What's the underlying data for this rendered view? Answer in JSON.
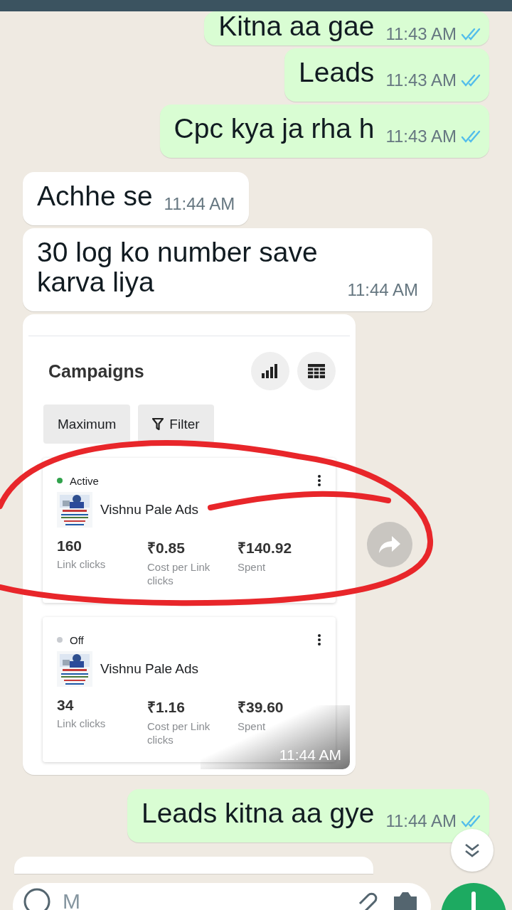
{
  "messages": [
    {
      "kind": "text",
      "outgoing": true,
      "text": "Kitna aa gae",
      "time": "11:43 AM",
      "read": true
    },
    {
      "kind": "text",
      "outgoing": true,
      "text": "Leads",
      "time": "11:43 AM",
      "read": true
    },
    {
      "kind": "text",
      "outgoing": true,
      "text": "Cpc kya ja rha h",
      "time": "11:43 AM",
      "read": true
    },
    {
      "kind": "text",
      "outgoing": false,
      "text": "Achhe se",
      "time": "11:44 AM"
    },
    {
      "kind": "text",
      "outgoing": false,
      "text": "30 log ko number save karva liya",
      "time": "11:44 AM"
    },
    {
      "outgoing": false,
      "time": "11:44 AM",
      "screenshot": {
        "title": "Campaigns",
        "sort_button": "Maximum",
        "filter_button": "Filter",
        "campaigns": [
          {
            "status": "Active",
            "active": true,
            "name": "Vishnu Pale Ads",
            "metrics": [
              {
                "value": "160",
                "label": "Link clicks"
              },
              {
                "value": "₹0.85",
                "label": "Cost per Link clicks"
              },
              {
                "value": "₹140.92",
                "label": "Spent"
              }
            ]
          },
          {
            "status": "Off",
            "active": false,
            "name": "Vishnu Pale Ads",
            "metrics": [
              {
                "value": "34",
                "label": "Link clicks"
              },
              {
                "value": "₹1.16",
                "label": "Cost per Link clicks"
              },
              {
                "value": "₹39.60",
                "label": "Spent"
              }
            ]
          }
        ]
      }
    },
    {
      "kind": "text",
      "outgoing": true,
      "text": "Leads kitna aa gye",
      "time": "11:44 AM",
      "read": true
    },
    {
      "kind": "cut_off",
      "outgoing": false
    }
  ],
  "composer": {
    "placeholder": "M"
  }
}
